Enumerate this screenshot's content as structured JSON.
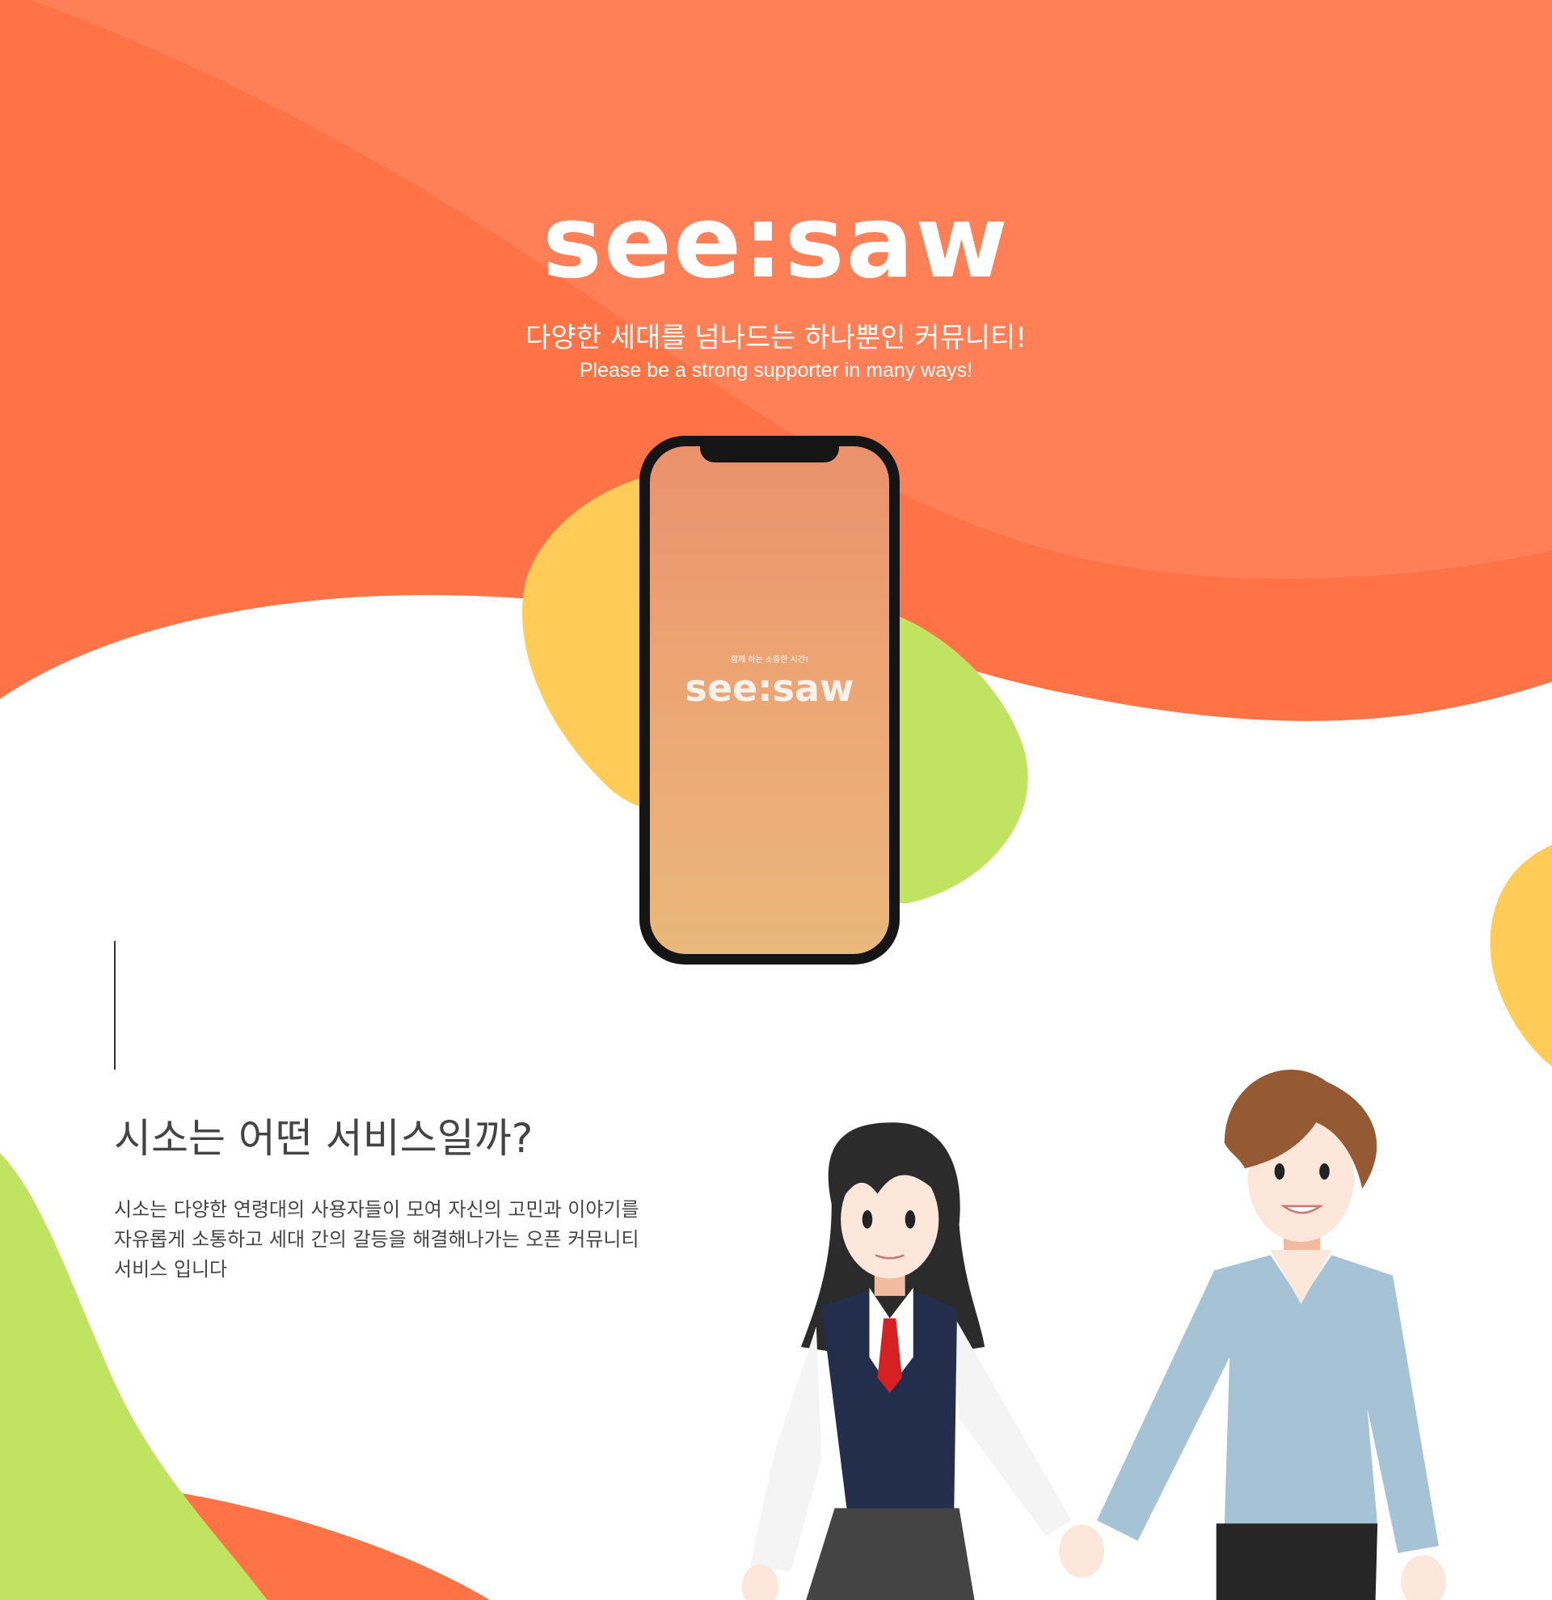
{
  "hero": {
    "logo": "see:saw",
    "tagline": "다양한 세대를 넘나드는 하나뿐인 커뮤니티!",
    "subtitle": "Please be a strong supporter in many ways!"
  },
  "phone": {
    "screen_tagline": "함께 하는 소중한 시간!",
    "screen_logo": "see:saw"
  },
  "about": {
    "heading": "시소는 어떤 서비스일까?",
    "body_lines": [
      "시소는 다양한 연령대의 사용자들이 모여 자신의 고민과 이야기를",
      "자유롭게 소통하고 세대 간의 갈등을 해결해나가는 오픈 커뮤니티",
      "서비스 입니다"
    ]
  },
  "colors": {
    "orange": "#ff7346",
    "light_orange": "#ff7f57",
    "yellow": "#ffcd57",
    "green": "#c1e362",
    "text": "#444444"
  }
}
